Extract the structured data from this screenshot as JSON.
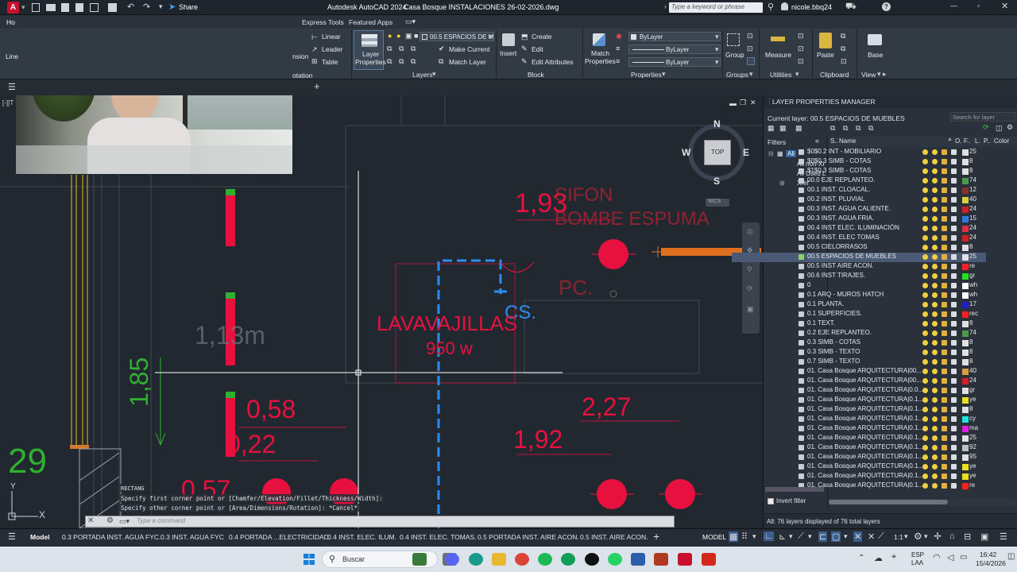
{
  "title_bar": {
    "app_title": "Autodesk AutoCAD 2024",
    "file_title": "Casa Bosque INSTALACIONES 26-02-2026.dwg",
    "share_label": "Share",
    "search_placeholder": "Type a keyword or phrase",
    "user": "nicole.bbq24"
  },
  "ribbon_tabs": [
    "Express Tools",
    "Featured Apps"
  ],
  "ribbon_partial": {
    "home_tab": "Ho",
    "line_label": "Line",
    "dimension_label": "nsion",
    "annotation_label": "otation"
  },
  "ribbon": {
    "annotation": {
      "linear": "Linear",
      "leader": "Leader",
      "table": "Table"
    },
    "layers": {
      "layer_properties": [
        "Layer",
        "Properties"
      ],
      "current_layer": "00.5 ESPACIOS DE M",
      "make_current": "Make Current",
      "match_layer": "Match Layer",
      "group_label": "Layers"
    },
    "block": {
      "insert": "Insert",
      "create": "Create",
      "edit": "Edit",
      "edit_attributes": "Edit Attributes",
      "group_label": "Block"
    },
    "properties": {
      "match": [
        "Match",
        "Properties"
      ],
      "color": "ByLayer",
      "linetype": "ByLayer",
      "lineweight": "ByLayer",
      "group_label": "Properties"
    },
    "groups": {
      "group": "Group",
      "group_label": "Groups"
    },
    "utilities": {
      "measure": "Measure",
      "group_label": "Utilities"
    },
    "clipboard": {
      "paste": "Paste",
      "group_label": "Clipboard"
    },
    "view": {
      "base": "Base",
      "group_label": "View"
    }
  },
  "viewcube": {
    "north": "N",
    "south": "S",
    "east": "E",
    "west": "W",
    "top": "TOP",
    "wcs": "WCS"
  },
  "drawing": {
    "dim_193": "1,93",
    "sifon": "SIFON",
    "bombe_espuma": "BOMBE ESPUMA",
    "pc": "PC.",
    "cs": "CS.",
    "lavavajillas": "LAVAVAJILLAS",
    "watts": "950 w",
    "dim_113": "1,13m",
    "dim_185": "1,85",
    "dim_058": "0,58",
    "dim_022": "0,22",
    "dim_227": "2,27",
    "dim_192": "1,92",
    "dim_29": "29",
    "dim_057": "0,57"
  },
  "command": {
    "history": [
      "RECTANG",
      "Specify first corner point or [Chamfer/Elevation/Fillet/Thickness/Width]:",
      "Specify other corner point or [Area/Dimensions/Rotation]: *Cancel*"
    ],
    "placeholder": "Type a command"
  },
  "lpm": {
    "title": "LAYER PROPERTIES MANAGER",
    "current_layer": "Current layer: 00.5 ESPACIOS DE MUEBLES",
    "search_placeholder": "Search for layer",
    "filters_label": "Filters",
    "filter_tree": [
      "All",
      "All non-Xr",
      "All Used L",
      "Xref"
    ],
    "headers": {
      "s": "S..",
      "name": "Name",
      "o": "O.",
      "f": "F..",
      "l": "L.",
      "p": "P..",
      "color": "Color"
    },
    "layers": [
      {
        "name": "$0$0.2 INT - MOBILIARIO",
        "color": "#e0e0e0",
        "code": "25"
      },
      {
        "name": "$0$0.3 SIMB - COTAS",
        "color": "#e0e0e0",
        "code": "8"
      },
      {
        "name": "$1$0.3 SIMB - COTAS",
        "color": "#e0e0e0",
        "code": "8"
      },
      {
        "name": "00.0 EJE REPLANTEO.",
        "color": "#4a9a4a",
        "code": "74"
      },
      {
        "name": "00.1 INST. CLOACAL.",
        "color": "#8a3030",
        "code": "12"
      },
      {
        "name": "00.2 INST. PLUVIAL",
        "color": "#d8d040",
        "code": "40"
      },
      {
        "name": "00.3 INST. AGUA CALIENTE.",
        "color": "#d02020",
        "code": "24"
      },
      {
        "name": "00.3 INST. AGUA FRIA.",
        "color": "#2a7ae0",
        "code": "15"
      },
      {
        "name": "00.4 INST ELEC. ILUMINACIÓN",
        "color": "#e03040",
        "code": "24"
      },
      {
        "name": "00.4 INST. ELEC TOMAS",
        "color": "#d02020",
        "code": "24"
      },
      {
        "name": "00.5 CIELORRASOS",
        "color": "#e0e0e0",
        "code": "8"
      },
      {
        "name": "00.5 ESPACIOS DE MUEBLES",
        "color": "#e0e0e0",
        "code": "25",
        "selected": true
      },
      {
        "name": "00.5 INST AIRE ACON.",
        "color": "#ff2020",
        "code": "re"
      },
      {
        "name": "00.6 INST TIRAJES.",
        "color": "#20e020",
        "code": "gr"
      },
      {
        "name": "0",
        "color": "#ffffff",
        "code": "wh"
      },
      {
        "name": "0.1 ARQ - MUROS HATCH",
        "color": "#ffffff",
        "code": "wh"
      },
      {
        "name": "0.1 PLANTA.",
        "color": "#2020c0",
        "code": "17"
      },
      {
        "name": "0.1 SUPERFICIES.",
        "color": "#ff2020",
        "code": "rec"
      },
      {
        "name": "0.1 TEXT.",
        "color": "#e0e0e0",
        "code": "8"
      },
      {
        "name": "0.2 EJE REPLANTEO.",
        "color": "#4a9a4a",
        "code": "74"
      },
      {
        "name": "0.3 SIMB - COTAS",
        "color": "#e0e0e0",
        "code": "8"
      },
      {
        "name": "0.3 SIMB - TEXTO",
        "color": "#e0e0e0",
        "code": "8"
      },
      {
        "name": "0.7 SIMB - TEXTO",
        "color": "#e0e0e0",
        "code": "8"
      },
      {
        "name": "01. Casa Bosque ARQUITECTURA|00...",
        "color": "#d8a040",
        "code": "40"
      },
      {
        "name": "01. Casa Bosque ARQUITECTURA|00...",
        "color": "#d02020",
        "code": "24"
      },
      {
        "name": "01. Casa Bosque ARQUITECTURA|0.0...",
        "color": "#e0e0e0",
        "code": "gr"
      },
      {
        "name": "01. Casa Bosque ARQUITECTURA|0.1...",
        "color": "#e8e020",
        "code": "ye"
      },
      {
        "name": "01. Casa Bosque ARQUITECTURA|0.1...",
        "color": "#e0e0e0",
        "code": "8"
      },
      {
        "name": "01. Casa Bosque ARQUITECTURA|0.1...",
        "color": "#20e0e0",
        "code": "cy"
      },
      {
        "name": "01. Casa Bosque ARQUITECTURA|0.1...",
        "color": "#e020e0",
        "code": "ma"
      },
      {
        "name": "01. Casa Bosque ARQUITECTURA|0.1...",
        "color": "#e0e0e0",
        "code": "25"
      },
      {
        "name": "01. Casa Bosque ARQUITECTURA|0.1...",
        "color": "#c0c0c0",
        "code": "92"
      },
      {
        "name": "01. Casa Bosque ARQUITECTURA|0.1...",
        "color": "#e0e0e0",
        "code": "95"
      },
      {
        "name": "01. Casa Bosque ARQUITECTURA|0.1...",
        "color": "#e8e020",
        "code": "ye"
      },
      {
        "name": "01. Casa Bosque ARQUITECTURA|0.1...",
        "color": "#e8e020",
        "code": "ye"
      },
      {
        "name": "01. Casa Bosque ARQUITECTURA|0.1...",
        "color": "#ff2020",
        "code": "re"
      }
    ],
    "invert_filter": "Invert filter",
    "status": "All: 76 layers displayed of 76 total layers"
  },
  "layout_tabs": [
    "Model",
    "0.3 PORTADA INST. AGUA FYC.",
    "0.3 INST. AGUA FYC",
    "0.4 PORTADA ...ELECTRICIDAD.",
    "0.4 INST. ELEC. ILUM.",
    "0.4 INST. ELEC. TOMAS.",
    "0.5 PORTADA INST. AIRE ACON.",
    "0.5 INST. AIRE ACON."
  ],
  "status_bar": {
    "model": "MODEL",
    "scale": "1:1"
  },
  "taskbar": {
    "search": "Buscar",
    "lang": "ESP",
    "lang2": "LAA",
    "time": "16:42",
    "date": "15/4/2026"
  }
}
